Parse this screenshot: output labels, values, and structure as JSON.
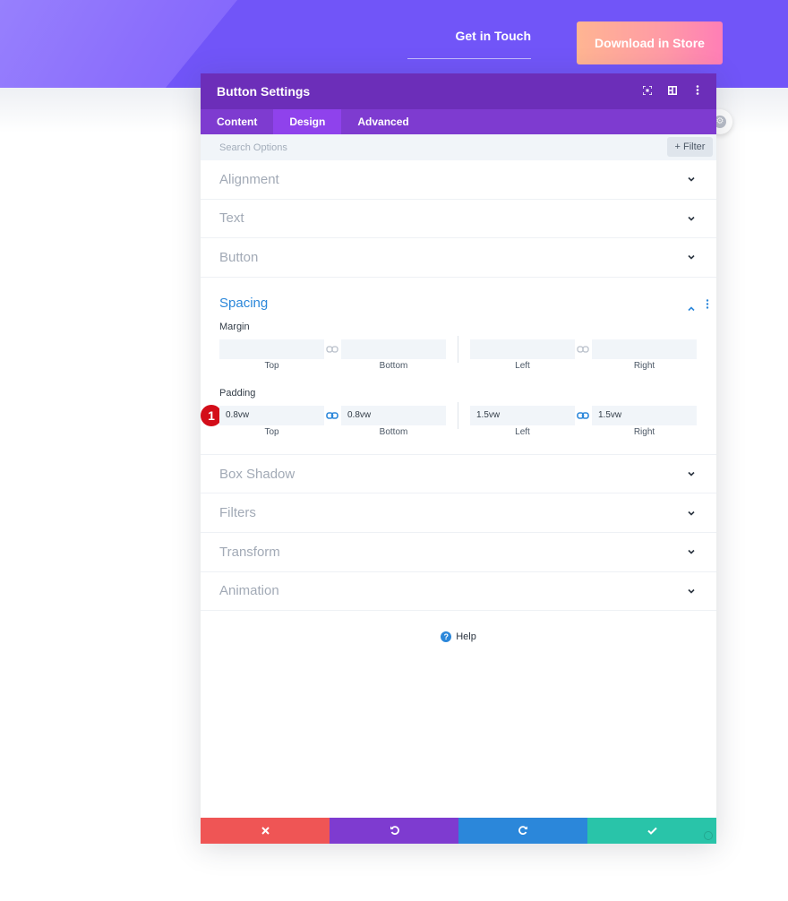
{
  "hero": {
    "nav_link": "Get in Touch",
    "cta_button": "Download in Store"
  },
  "modal": {
    "title": "Button Settings",
    "header_icons": [
      "expand-icon",
      "sidebar-layout-icon",
      "more-vertical-icon"
    ],
    "tabs": [
      {
        "label": "Content",
        "active": false
      },
      {
        "label": "Design",
        "active": true
      },
      {
        "label": "Advanced",
        "active": false
      }
    ],
    "search": {
      "placeholder": "Search Options",
      "filter_label": "Filter"
    },
    "sections_before": [
      {
        "title": "Alignment"
      },
      {
        "title": "Text"
      },
      {
        "title": "Button"
      }
    ],
    "spacing": {
      "title": "Spacing",
      "margin": {
        "label": "Margin",
        "top": "",
        "bottom": "",
        "left": "",
        "right": "",
        "captions": [
          "Top",
          "Bottom",
          "Left",
          "Right"
        ]
      },
      "padding": {
        "label": "Padding",
        "top": "0.8vw",
        "bottom": "0.8vw",
        "left": "1.5vw",
        "right": "1.5vw",
        "captions": [
          "Top",
          "Bottom",
          "Left",
          "Right"
        ]
      },
      "badge": "1"
    },
    "sections_after": [
      {
        "title": "Box Shadow"
      },
      {
        "title": "Filters"
      },
      {
        "title": "Transform"
      },
      {
        "title": "Animation"
      }
    ],
    "help_label": "Help",
    "footer_icons": [
      "close-icon",
      "undo-icon",
      "redo-icon",
      "checkmark-icon"
    ]
  },
  "colors": {
    "hero_bg": "#7155f8",
    "modal_header": "#6c2eb9",
    "tab_bar": "#7e3bd0",
    "active_tab": "#8f42ec",
    "accent_blue": "#2b87da",
    "cancel_red": "#ef5555",
    "save_green": "#29c4a9",
    "badge_red": "#d30d19"
  }
}
